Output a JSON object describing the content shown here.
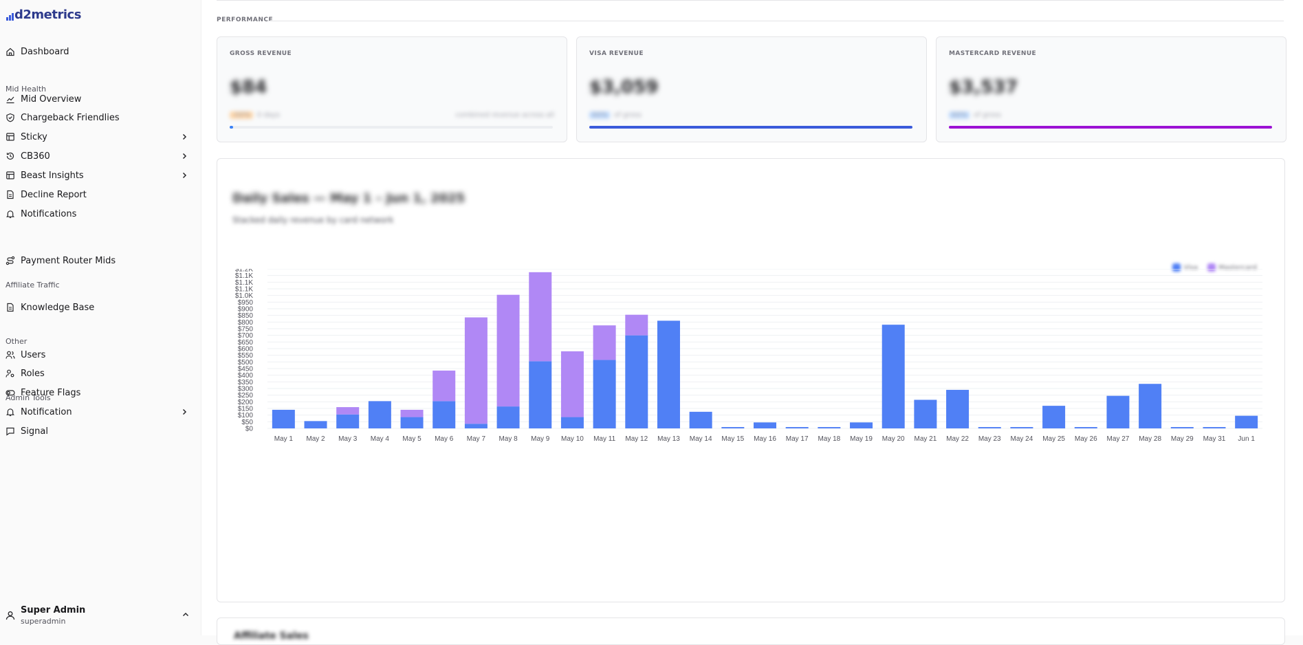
{
  "brand": {
    "name": "d2metrics"
  },
  "sidebar": {
    "items": [
      {
        "label": "Dashboard",
        "icon": "home-icon"
      },
      {
        "section": "Mid Health"
      },
      {
        "label": "Mid Overview",
        "icon": "chart-line-icon"
      },
      {
        "label": "Chargeback Friendlies",
        "icon": "shield-check-icon"
      },
      {
        "label": "Sticky",
        "icon": "table-icon",
        "expand": true
      },
      {
        "label": "CB360",
        "icon": "history-icon",
        "expand": true
      },
      {
        "label": "Beast Insights",
        "icon": "table-icon",
        "expand": true
      },
      {
        "label": "Decline Report",
        "icon": "document-icon"
      },
      {
        "label": "Notifications",
        "icon": "bell-icon"
      },
      {
        "section": "Affiliate Traffic"
      },
      {
        "label": "Payment Router Mids",
        "icon": "route-icon"
      },
      {
        "section": "Other"
      },
      {
        "label": "Knowledge Base",
        "icon": "document-icon"
      },
      {
        "section": "Admin Tools"
      },
      {
        "label": "Users",
        "icon": "users-icon"
      },
      {
        "label": "Roles",
        "icon": "user-key-icon"
      },
      {
        "label": "Feature Flags",
        "icon": "toggle-icon"
      },
      {
        "label": "Notification",
        "icon": "bell-icon",
        "expand": true
      },
      {
        "label": "Signal",
        "icon": "message-icon"
      }
    ],
    "user": {
      "name": "Super Admin",
      "handle": "superadmin"
    }
  },
  "performance": {
    "label": "PERFORMANCE",
    "cards": [
      {
        "title": "GROSS REVENUE",
        "value": "$84",
        "sub_pill": "-00%",
        "sub_text": "0 days",
        "right_text": "combined revenue across all",
        "pill_color": "#fed7aa",
        "bar_color": "#3b82f6",
        "bar_fraction": 0.01
      },
      {
        "title": "VISA REVENUE",
        "value": "$3,059",
        "sub_pill": "00%",
        "sub_text": "of gross",
        "right_text": "",
        "pill_color": "#bfdbfe",
        "bar_color": "#3b5bdb",
        "bar_fraction": 1.0
      },
      {
        "title": "MASTERCARD REVENUE",
        "value": "$3,537",
        "sub_pill": "00%",
        "sub_text": "of gross",
        "right_text": "",
        "pill_color": "#bfdbfe",
        "bar_color": "#9c12d4",
        "bar_fraction": 1.0
      }
    ]
  },
  "chart_section": {
    "title": "Daily Sales — May 1 – Jun 1, 2025",
    "subtitle": "Stacked daily revenue by card network",
    "legend": [
      "Visa",
      "Mastercard"
    ],
    "bottom_title": "Affiliate Sales"
  },
  "chart_data": {
    "type": "bar",
    "stacked": true,
    "categories": [
      "May 1",
      "May 2",
      "May 3",
      "May 4",
      "May 5",
      "May 6",
      "May 7",
      "May 8",
      "May 9",
      "May 10",
      "May 11",
      "May 12",
      "May 13",
      "May 14",
      "May 15",
      "May 16",
      "May 17",
      "May 18",
      "May 19",
      "May 20",
      "May 21",
      "May 22",
      "May 23",
      "May 24",
      "May 25",
      "May 26",
      "May 27",
      "May 28",
      "May 29",
      "May 31",
      "Jun 1"
    ],
    "series": [
      {
        "name": "Visa",
        "color": "#5080f5",
        "values": [
          140,
          55,
          105,
          205,
          85,
          205,
          35,
          165,
          505,
          85,
          515,
          700,
          810,
          125,
          10,
          45,
          10,
          10,
          45,
          780,
          215,
          290,
          10,
          10,
          170,
          10,
          245,
          335,
          10,
          10,
          95
        ]
      },
      {
        "name": "Mastercard",
        "color": "#b088f5",
        "values": [
          0,
          0,
          55,
          0,
          55,
          230,
          800,
          840,
          670,
          495,
          260,
          155,
          0,
          0,
          0,
          0,
          0,
          0,
          0,
          0,
          0,
          0,
          0,
          0,
          0,
          0,
          0,
          0,
          0,
          0,
          0
        ]
      }
    ],
    "yticks": [
      "$0",
      "$50",
      "$100",
      "$150",
      "$200",
      "$250",
      "$300",
      "$350",
      "$400",
      "$450",
      "$500",
      "$550",
      "$600",
      "$650",
      "$700",
      "$750",
      "$800",
      "$850",
      "$900",
      "$950",
      "$1.0K",
      "$1.1K",
      "$1.1K",
      "$1.1K",
      "$1.2K"
    ],
    "ylim": [
      0,
      1200
    ],
    "grid": true,
    "legend_position": "top-right"
  }
}
